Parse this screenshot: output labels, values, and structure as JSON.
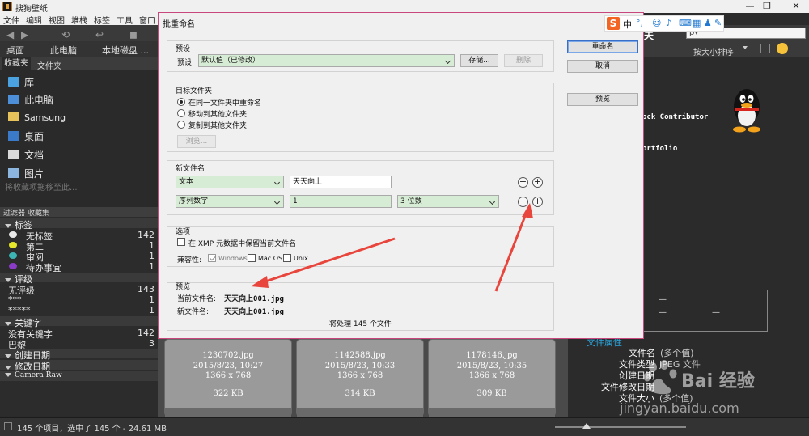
{
  "app": {
    "title": "搜狗壁纸",
    "menu": [
      "文件",
      "编辑",
      "视图",
      "堆栈",
      "标签",
      "工具",
      "窗口"
    ],
    "window_controls": [
      "—",
      "❐",
      "✕"
    ]
  },
  "path": [
    "桌面",
    "此电脑",
    "本地磁盘 ..."
  ],
  "toolbar_right": {
    "partial_label": "夫",
    "search_placeholder": "ρ▾",
    "sort_label": "按大小排序"
  },
  "favorites_panel": {
    "tabs": [
      "收藏夹",
      "文件夹"
    ],
    "items": [
      "库",
      "此电脑",
      "Samsung",
      "桌面",
      "文档",
      "图片"
    ],
    "drag_hint": "将收藏项拖移至此..."
  },
  "filter_panel": {
    "tabs": [
      "过滤器",
      "收藏集"
    ],
    "sections": {
      "labels": {
        "title": "标签",
        "rows": [
          {
            "label": "无标签",
            "count": "142",
            "color": "#e9e9e9"
          },
          {
            "label": "第二",
            "count": "1",
            "color": "#e6e62a"
          },
          {
            "label": "审阅",
            "count": "1",
            "color": "#3cb4b4"
          },
          {
            "label": "待办事宜",
            "count": "1",
            "color": "#8a3cc8"
          }
        ]
      },
      "ratings": {
        "title": "评级",
        "rows": [
          {
            "label": "无评级",
            "count": "143"
          },
          {
            "label": "***",
            "count": "1"
          },
          {
            "label": "*****",
            "count": "1"
          }
        ]
      },
      "keywords": {
        "title": "关键字",
        "rows": [
          {
            "label": "没有关键字",
            "count": "142"
          },
          {
            "label": "巴黎",
            "count": "3"
          }
        ]
      },
      "date_created": "创建日期",
      "date_modified": "修改日期",
      "camera_raw": "Camera Raw"
    }
  },
  "thumbnails": [
    {
      "name": "1230702.jpg",
      "date": "2015/8/23, 10:27",
      "dims": "1366 x 768",
      "size": "322 KB"
    },
    {
      "name": "1142588.jpg",
      "date": "2015/8/23, 10:33",
      "dims": "1366 x 768",
      "size": "314 KB"
    },
    {
      "name": "1178146.jpg",
      "date": "2015/8/23, 10:35",
      "dims": "1366 x 768",
      "size": "309 KB"
    }
  ],
  "right_panel": {
    "line1": "ock Contributor",
    "line2": "ortfolio",
    "preview_dashes": [
      "—",
      "—",
      "—"
    ],
    "metadata_title": "文件属性",
    "metadata": [
      {
        "key": "文件名",
        "value": "(多个值)"
      },
      {
        "key": "文件类型",
        "value": "JPEG 文件"
      },
      {
        "key": "创建日期",
        "value": ""
      },
      {
        "key": "文件修改日期",
        "value": ""
      },
      {
        "key": "文件大小",
        "value": "(多个值)"
      }
    ]
  },
  "status_bar": {
    "text": "145 个项目，选中了 145 个 - 24.61 MB"
  },
  "dialog": {
    "title": "批重命名",
    "close": "✕",
    "preset": {
      "group_label": "预设",
      "field_label": "预设:",
      "value": "默认值（已修改）",
      "save_button": "存储...",
      "delete_button": "删除"
    },
    "target": {
      "group_label": "目标文件夹",
      "options": [
        {
          "label": "在同一文件夹中重命名",
          "selected": true
        },
        {
          "label": "移动到其他文件夹",
          "selected": false
        },
        {
          "label": "复制到其他文件夹",
          "selected": false
        }
      ],
      "browse_button": "浏览..."
    },
    "new_name": {
      "group_label": "新文件名",
      "row1": {
        "type": "文本",
        "value": "天天向上"
      },
      "row2": {
        "type": "序列数字",
        "value": "1",
        "digits": "3 位数"
      },
      "minus": "−",
      "plus": "+"
    },
    "options": {
      "group_label": "选项",
      "keep_xmp": "在 XMP 元数据中保留当前文件名",
      "compat_label": "兼容性:",
      "windows": "Windows",
      "mac": "Mac OS",
      "unix": "Unix"
    },
    "preview": {
      "group_label": "预览",
      "current_label": "当前文件名:",
      "current_value": "天天向上001.jpg",
      "new_label": "新文件名:",
      "new_value": "天天向上001.jpg",
      "summary": "将处理 145 个文件"
    },
    "buttons": {
      "rename": "重命名",
      "cancel": "取消",
      "preview": "预览"
    }
  },
  "ime": {
    "logo": "S",
    "mode": "中",
    "punct": "°,"
  },
  "watermark": {
    "brand": "Bai 经验",
    "url": "jingyan.baidu.com"
  },
  "colors": {
    "annotation_arrow": "#e8453c",
    "dialog_border": "#c8477d",
    "combo_green": "#d7ecd4"
  }
}
